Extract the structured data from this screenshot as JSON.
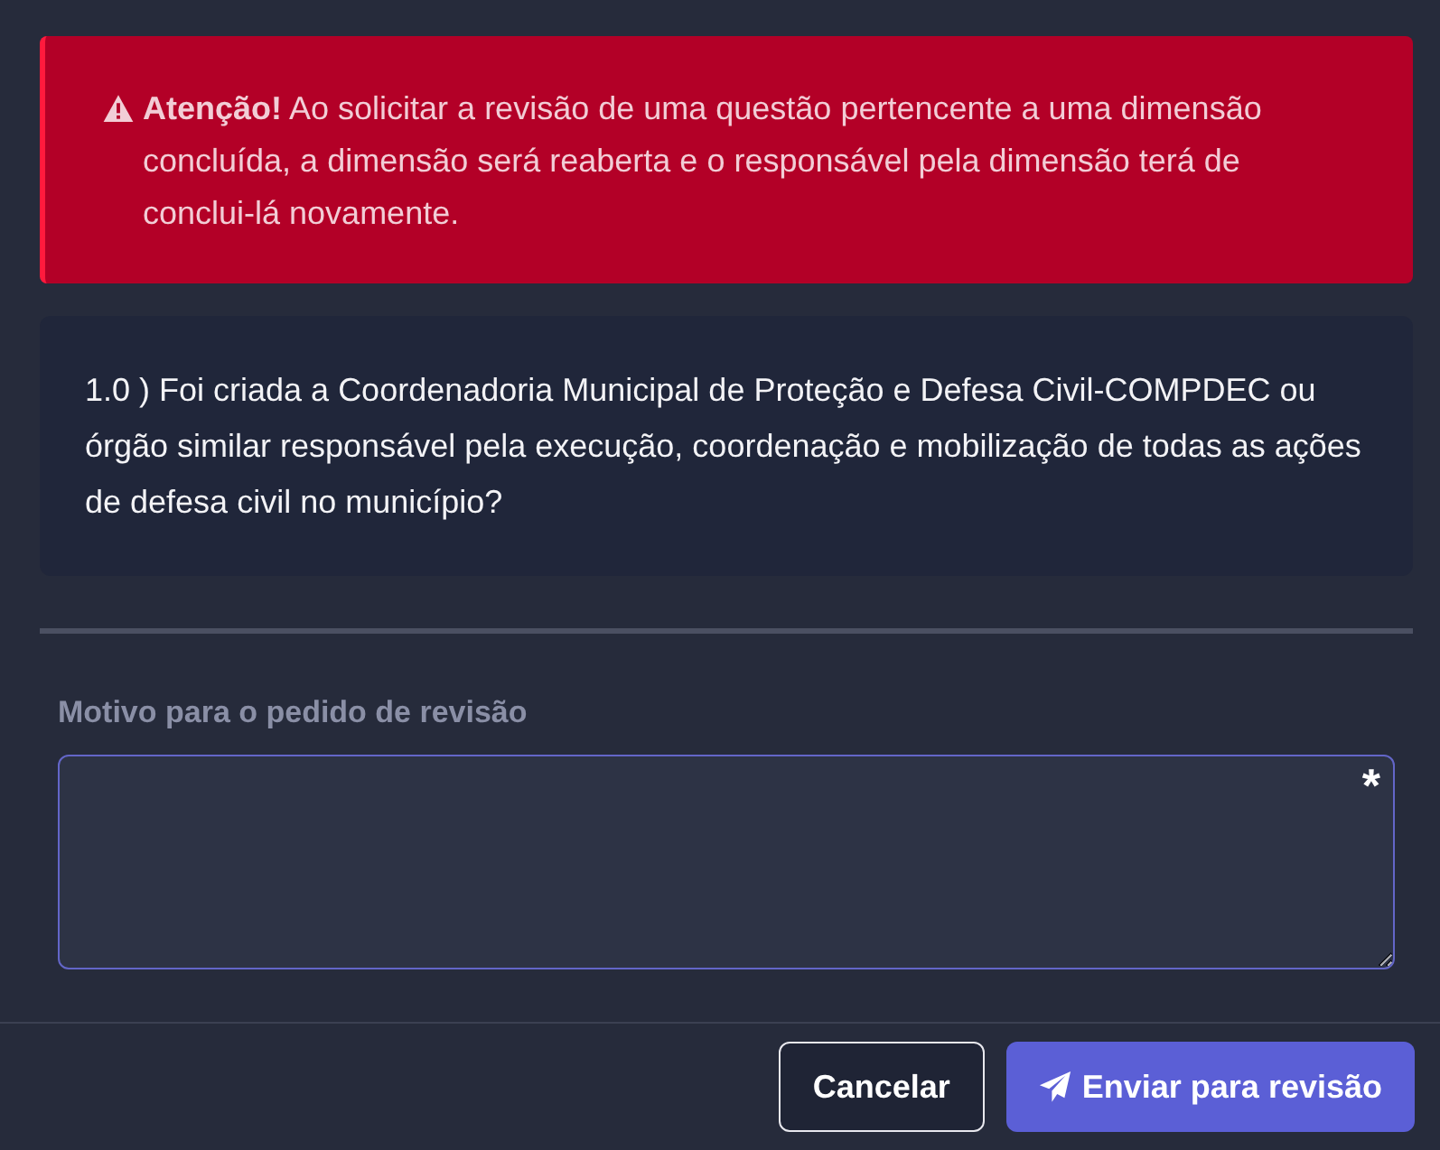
{
  "alert": {
    "text": "**Atenção!** Ao solicitar a revisão de uma questão pertencente a uma dimensão concluída, a dimensão será reaberta e o responsável pela dimensão terá de conclui-lá novamente."
  },
  "question": {
    "text": "1.0 ) Foi criada a Coordenadoria Municipal de Proteção e Defesa Civil-COMPDEC ou órgão similar responsável pela execução, coordenação e mobilização de todas as ações de defesa civil no município?"
  },
  "reason_field": {
    "label": "Motivo para o pedido de revisão",
    "required_mark": "*"
  },
  "buttons": [
    {
      "kind": "secondary",
      "label": "Cancelar"
    },
    {
      "kind": "primary",
      "label": "Enviar para revisão"
    }
  ]
}
